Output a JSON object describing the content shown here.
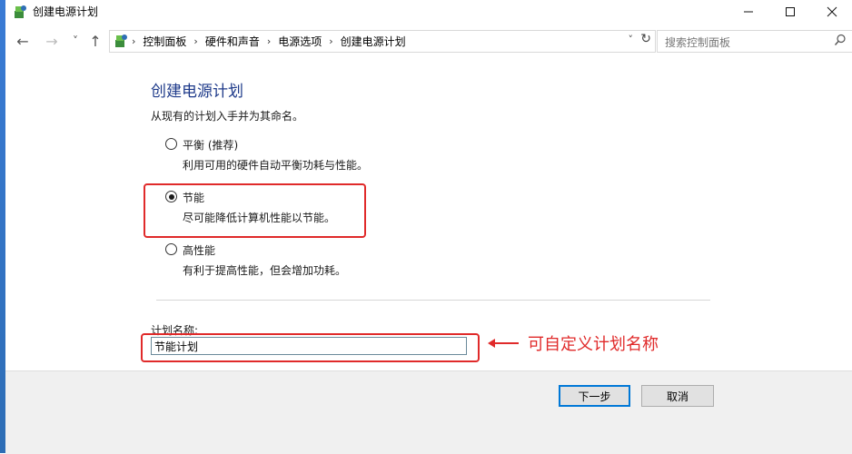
{
  "window": {
    "title": "创建电源计划",
    "minimize_icon": "minimize-icon",
    "maximize_icon": "maximize-icon",
    "close_icon": "close-icon"
  },
  "nav": {
    "back": "←",
    "forward": "→",
    "recent": "˅",
    "up": "↑"
  },
  "address": {
    "crumbs": [
      "控制面板",
      "硬件和声音",
      "电源选项",
      "创建电源计划"
    ],
    "separator": "›",
    "dropdown": "˅",
    "refresh": "↻"
  },
  "search": {
    "placeholder": "搜索控制面板"
  },
  "page": {
    "heading": "创建电源计划",
    "intro": "从现有的计划入手并为其命名。",
    "options": [
      {
        "label": "平衡 (推荐)",
        "desc": "利用可用的硬件自动平衡功耗与性能。",
        "selected": false
      },
      {
        "label": "节能",
        "desc": "尽可能降低计算机性能以节能。",
        "selected": true
      },
      {
        "label": "高性能",
        "desc": "有利于提高性能，但会增加功耗。",
        "selected": false
      }
    ],
    "plan_name_label": "计划名称:",
    "plan_name_value": "节能计划",
    "annotation": "可自定义计划名称",
    "highlight_color": "#e02a2a"
  },
  "buttons": {
    "next": "下一步",
    "cancel": "取消"
  }
}
